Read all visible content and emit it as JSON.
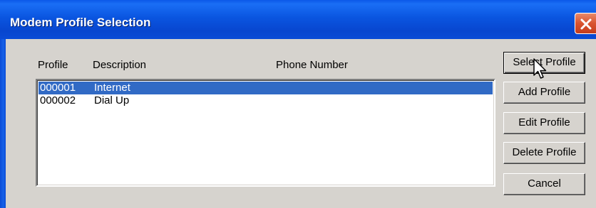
{
  "window": {
    "title": "Modem Profile Selection",
    "close_icon": "close-x-icon"
  },
  "columns": {
    "profile": "Profile",
    "description": "Description",
    "phone": "Phone Number"
  },
  "profiles": [
    {
      "profile": "000001",
      "description": "Internet",
      "phone": "",
      "selected": true
    },
    {
      "profile": "000002",
      "description": "Dial Up",
      "phone": "",
      "selected": false
    }
  ],
  "buttons": {
    "select": "Select Profile",
    "add": "Add Profile",
    "edit": "Edit Profile",
    "delete": "Delete Profile",
    "cancel": "Cancel"
  },
  "colors": {
    "titlebar": "#0a55e0",
    "selection": "#316ac5",
    "dialog_face": "#d6d3ce",
    "close_button": "#d9532f"
  }
}
